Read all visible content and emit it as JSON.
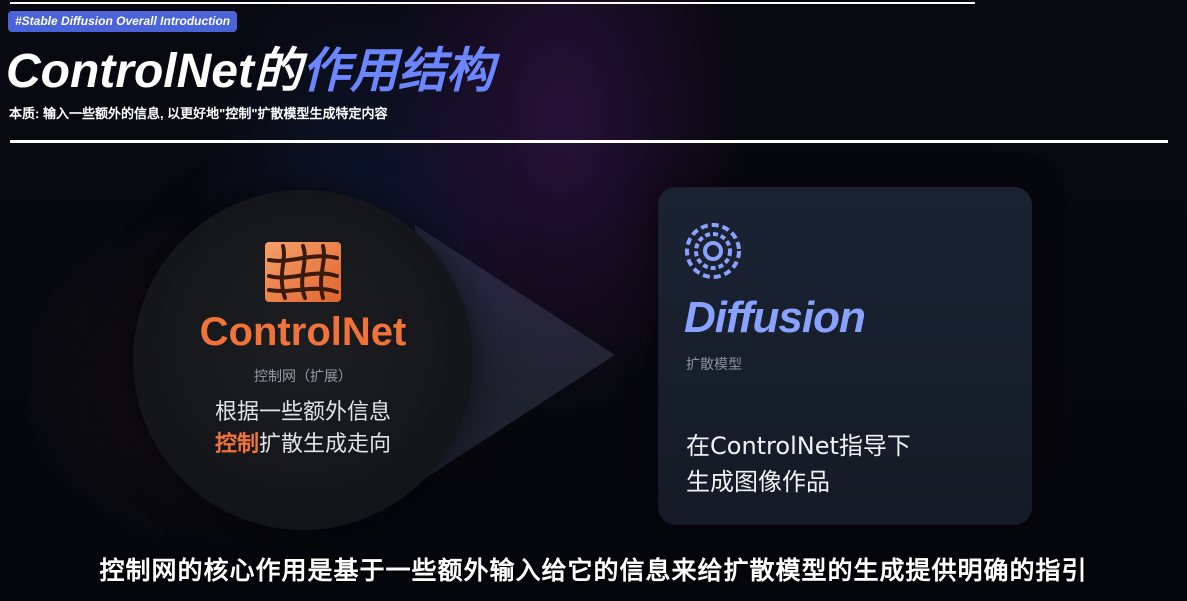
{
  "header": {
    "tag": "#Stable Diffusion Overall Introduction",
    "title_part1": "ControlNet的",
    "title_part2": "作用结构",
    "subtitle": "本质: 输入一些额外的信息, 以更好地\"控制\"扩散模型生成特定内容"
  },
  "controlnet_panel": {
    "icon": "grid-warp-icon",
    "name": "ControlNet",
    "sub": "控制网（扩展）",
    "desc_line1": "根据一些额外信息",
    "desc_accent": "控制",
    "desc_line2_rest": "扩散生成走向",
    "accent_color": "#f0743a"
  },
  "diffusion_panel": {
    "icon": "concentric-dashed-circles-icon",
    "name": "Diffusion",
    "sub": "扩散模型",
    "desc_line1": "在ControlNet指导下",
    "desc_line2": "生成图像作品",
    "accent_color": "#8aa2ff"
  },
  "caption": "控制网的核心作用是基于一些额外输入给它的信息来给扩散模型的生成提供明确的指引"
}
